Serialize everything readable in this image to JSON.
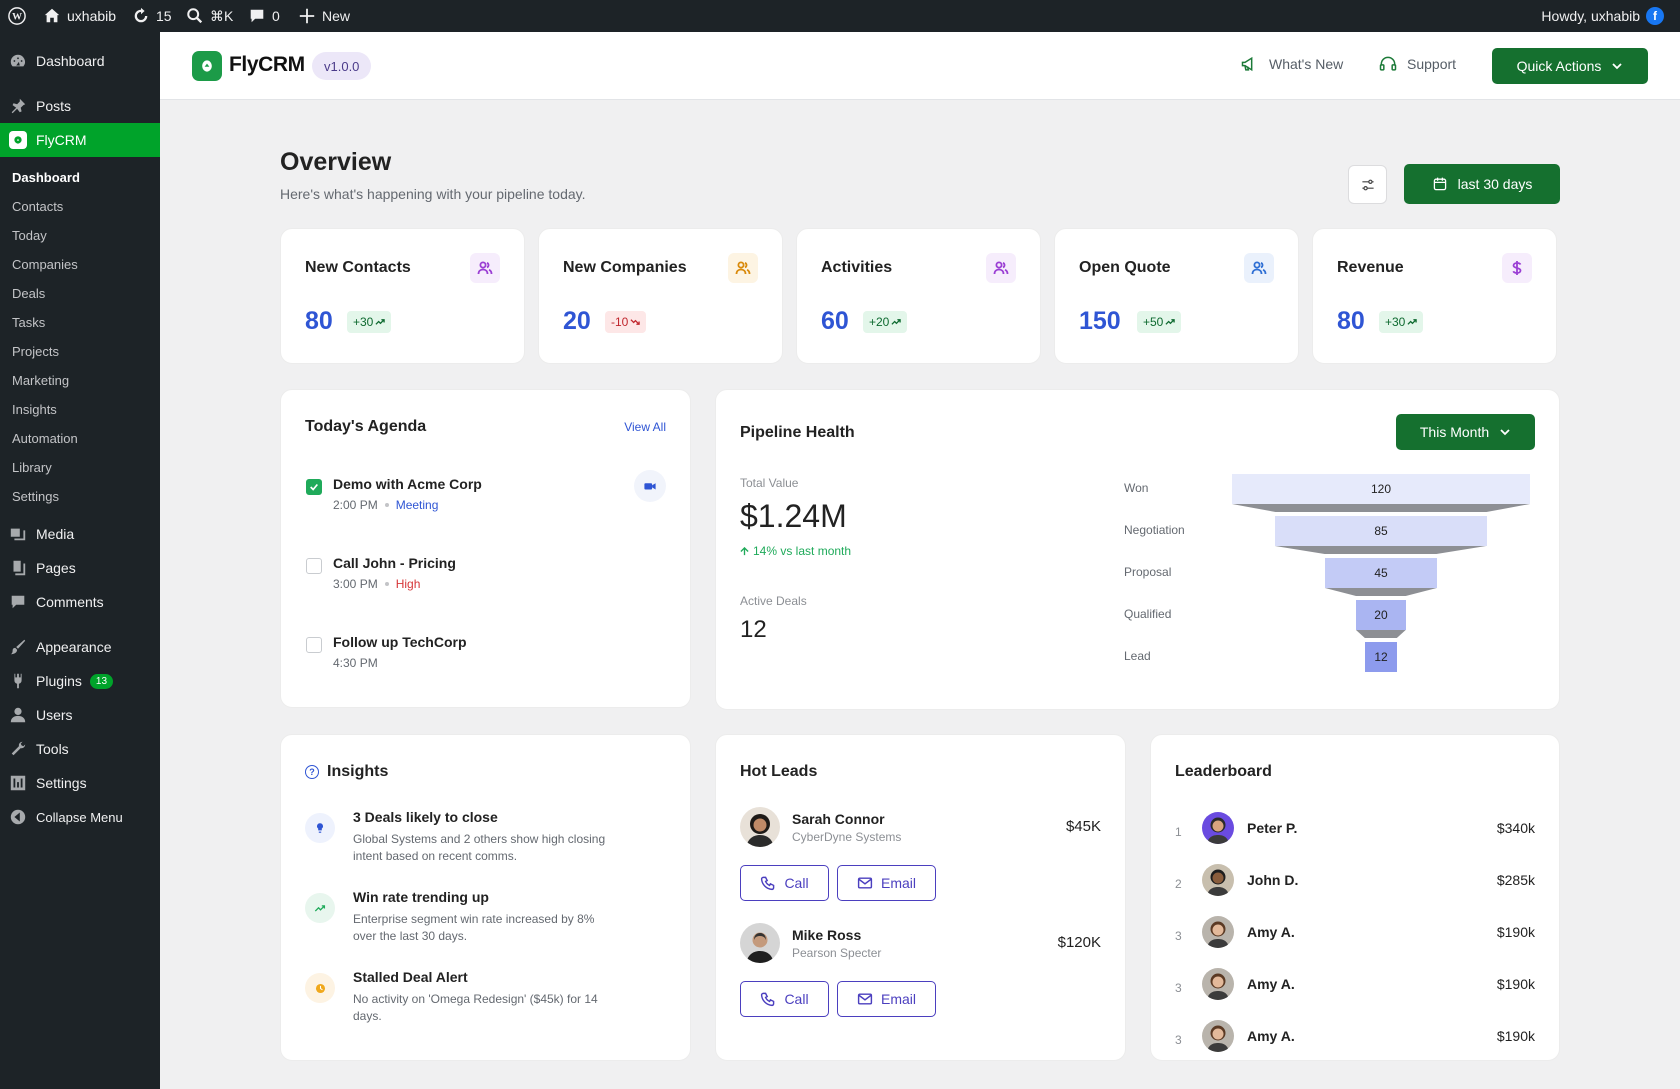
{
  "adminbar": {
    "site_name": "uxhabib",
    "updates_count": "15",
    "search_shortcut": "⌘K",
    "comments_count": "0",
    "new_label": "New",
    "howdy": "Howdy, uxhabib"
  },
  "sidebar": {
    "dashboard": "Dashboard",
    "posts": "Posts",
    "flycrm": "FlyCRM",
    "submenu": [
      "Dashboard",
      "Contacts",
      "Today",
      "Companies",
      "Deals",
      "Tasks",
      "Projects",
      "Marketing",
      "Insights",
      "Automation",
      "Library",
      "Settings"
    ],
    "media": "Media",
    "pages": "Pages",
    "comments": "Comments",
    "appearance": "Appearance",
    "plugins": "Plugins",
    "plugins_badge": "13",
    "users": "Users",
    "tools": "Tools",
    "settings": "Settings",
    "collapse": "Collapse Menu"
  },
  "header": {
    "brand": "FlyCRM",
    "version": "v1.0.0",
    "whats_new": "What's New",
    "support": "Support",
    "quick_actions": "Quick Actions"
  },
  "overview": {
    "title": "Overview",
    "subtitle": "Here's what's happening with your pipeline today.",
    "date_range": "last 30 days"
  },
  "stats": [
    {
      "label": "New Contacts",
      "value": "80",
      "delta": "+30",
      "trend": "up",
      "icon": "users-icon",
      "icon_color": "#9b3fd4",
      "icon_bg": "#f6edfc"
    },
    {
      "label": "New Companies",
      "value": "20",
      "delta": "-10",
      "trend": "down",
      "icon": "users-icon",
      "icon_color": "#d98a0b",
      "icon_bg": "#fdf4e3"
    },
    {
      "label": "Activities",
      "value": "60",
      "delta": "+20",
      "trend": "up",
      "icon": "users-icon",
      "icon_color": "#9b3fd4",
      "icon_bg": "#f6edfc"
    },
    {
      "label": "Open Quote",
      "value": "150",
      "delta": "+50",
      "trend": "up",
      "icon": "users-icon",
      "icon_color": "#2f6fd4",
      "icon_bg": "#eaf1fc"
    },
    {
      "label": "Revenue",
      "value": "80",
      "delta": "+30",
      "trend": "up",
      "icon": "dollar-icon",
      "icon_color": "#9b3fd4",
      "icon_bg": "#f6edfc"
    }
  ],
  "agenda": {
    "title": "Today's Agenda",
    "view_all": "View All",
    "items": [
      {
        "title": "Demo with Acme Corp",
        "time": "2:00 PM",
        "tag": "Meeting",
        "checked": true
      },
      {
        "title": "Call John - Pricing",
        "time": "3:00 PM",
        "tag": "High",
        "checked": false
      },
      {
        "title": "Follow up TechCorp",
        "time": "4:30 PM",
        "tag": "",
        "checked": false
      }
    ]
  },
  "pipeline": {
    "title": "Pipeline Health",
    "period": "This Month",
    "total_value_label": "Total Value",
    "total_value": "$1.24M",
    "change": "14% vs last month",
    "active_deals_label": "Active Deals",
    "active_deals": "12"
  },
  "chart_data": {
    "type": "bar",
    "categories": [
      "Won",
      "Negotiation",
      "Proposal",
      "Qualified",
      "Lead"
    ],
    "values": [
      120,
      85,
      45,
      20,
      12
    ],
    "title": "",
    "xlabel": "",
    "ylabel": ""
  },
  "insights": {
    "title": "Insights",
    "items": [
      {
        "title": "3 Deals likely to close",
        "desc": "Global Systems and 2 others show high closing intent based on recent comms.",
        "icon": "lightbulb-icon"
      },
      {
        "title": "Win rate trending up",
        "desc": "Enterprise segment win rate increased by 8% over the last 30 days.",
        "icon": "trend-up-icon"
      },
      {
        "title": "Stalled Deal Alert",
        "desc": "No activity on 'Omega Redesign' ($45k) for 14 days.",
        "icon": "clock-icon"
      }
    ]
  },
  "hot_leads": {
    "title": "Hot Leads",
    "call_label": "Call",
    "email_label": "Email",
    "leads": [
      {
        "name": "Sarah Connor",
        "company": "CyberDyne Systems",
        "amount": "$45K"
      },
      {
        "name": "Mike Ross",
        "company": "Pearson Specter",
        "amount": "$120K"
      }
    ]
  },
  "leaderboard": {
    "title": "Leaderboard",
    "rows": [
      {
        "rank": "1",
        "name": "Peter P.",
        "amount": "$340k"
      },
      {
        "rank": "2",
        "name": "John D.",
        "amount": "$285k"
      },
      {
        "rank": "3",
        "name": "Amy A.",
        "amount": "$190k"
      },
      {
        "rank": "3",
        "name": "Amy A.",
        "amount": "$190k"
      },
      {
        "rank": "3",
        "name": "Amy A.",
        "amount": "$190k"
      }
    ]
  },
  "colors": {
    "primary_green": "#15702f",
    "accent_blue": "#2f55d4",
    "wp_admin_dark": "#1d2327"
  }
}
